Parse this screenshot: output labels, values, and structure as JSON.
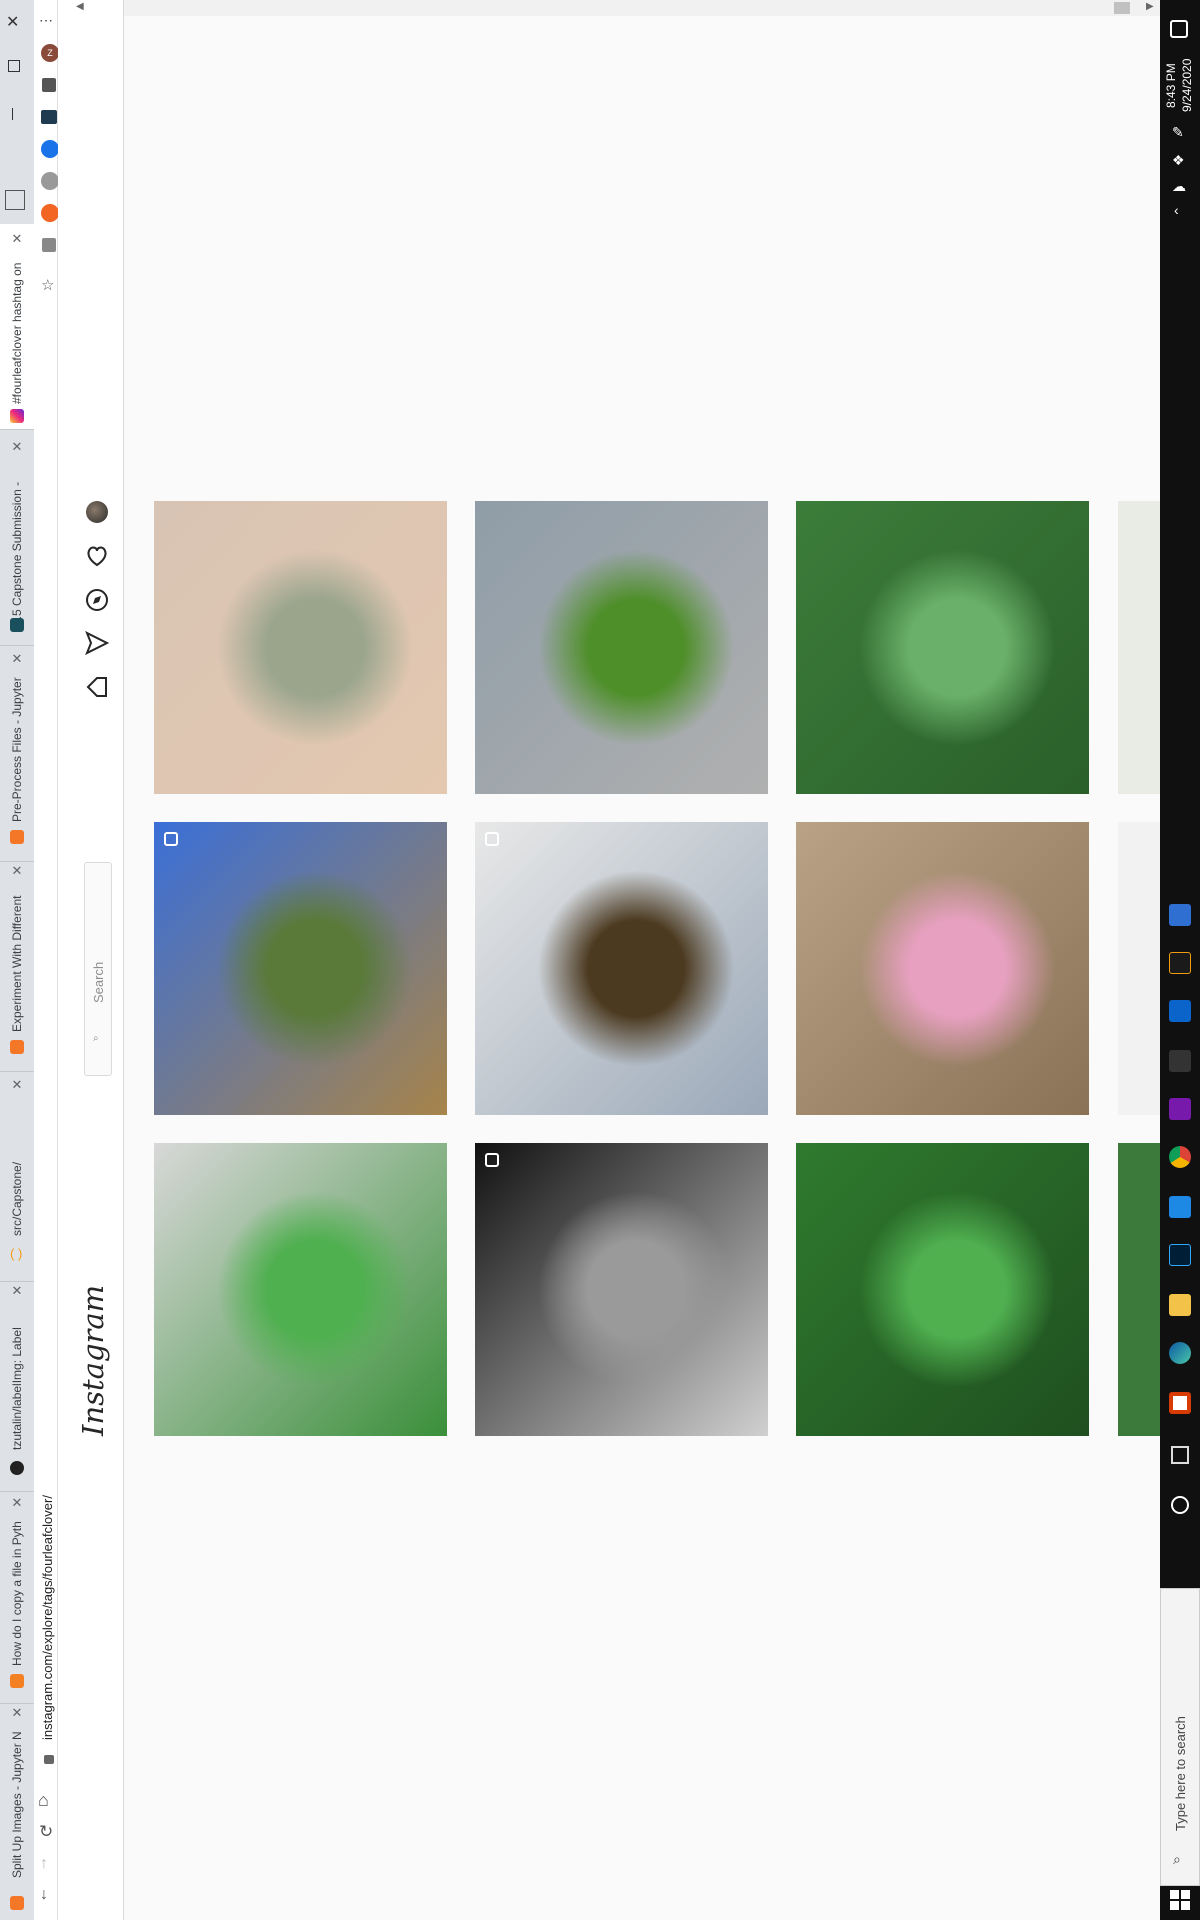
{
  "browser": {
    "tabs": [
      {
        "label": "#fourleafclover hashtag on",
        "active": true
      },
      {
        "label": "3.5 Capstone Submission -",
        "active": false
      },
      {
        "label": "Pre-Process Files - Jupyter",
        "active": false
      },
      {
        "label": "Experiment With Different",
        "active": false
      },
      {
        "label": "src/Capstone/",
        "active": false
      },
      {
        "label": "tzutalin/labelImg: Label",
        "active": false
      },
      {
        "label": "How do I copy a file in Pyth",
        "active": false
      },
      {
        "label": "Split Up Images - Jupyter N",
        "active": false
      }
    ],
    "url": "instagram.com/explore/tags/fourleafclover/",
    "url_icon": "lock-icon",
    "nav_icons": [
      "back-arrow-icon",
      "reload-icon",
      "forward-arrow-icon",
      "home-icon"
    ],
    "extension_icons": [
      "profile-icon",
      "puzzle-icon",
      "graph-icon",
      "ext-blue-icon",
      "ext-circle-icon",
      "ext-orange-icon",
      "ext-gray-icon",
      "star-icon"
    ],
    "profile_letter": "Z"
  },
  "instagram": {
    "logo": "Instagram",
    "search": {
      "placeholder": "Search"
    },
    "nav_icons": [
      "home-icon",
      "direct-icon",
      "explore-icon",
      "heart-icon",
      "avatar-icon"
    ]
  },
  "grid": {
    "tiles": [
      {
        "desc": "child-holding-clover",
        "colors": [
          "#d8c4b4",
          "#9aa58c",
          "#e4c8b0"
        ],
        "multi": false
      },
      {
        "desc": "clover-on-rock",
        "colors": [
          "#8f9da8",
          "#4f8f2a",
          "#b0b0b0"
        ],
        "multi": false
      },
      {
        "desc": "green-clover-leaves",
        "colors": [
          "#3c7d3a",
          "#6ab06a",
          "#2a5f2a"
        ],
        "multi": false
      },
      {
        "desc": "palm-trees-sky",
        "colors": [
          "#3a6fd8",
          "#5a7a3a",
          "#a7844a"
        ],
        "multi": true
      },
      {
        "desc": "clover-in-book",
        "colors": [
          "#e8e8e8",
          "#4c3a20",
          "#9aa8b8"
        ],
        "multi": true
      },
      {
        "desc": "kids-walking-path",
        "colors": [
          "#b9a285",
          "#e7a0c0",
          "#8a7256"
        ],
        "multi": false
      },
      {
        "desc": "clover-cookies",
        "colors": [
          "#d8d8d8",
          "#4fb04f",
          "#3a8f3a"
        ],
        "multi": false
      },
      {
        "desc": "smiling-man-bw",
        "colors": [
          "#111111",
          "#9a9a9a",
          "#d0d0d0"
        ],
        "multi": true
      },
      {
        "desc": "clover-patch",
        "colors": [
          "#2f7a2f",
          "#50b050",
          "#1f4f1f"
        ],
        "multi": false
      }
    ]
  },
  "taskbar": {
    "time": "8:43 PM",
    "date": "9/24/2020",
    "search_placeholder": "Type here to search",
    "app_icons": [
      "start-icon",
      "cortana-icon",
      "taskview-icon",
      "office-icon",
      "edge-icon",
      "files-icon",
      "photoshop-icon",
      "vscode-icon",
      "chrome-icon",
      "onenote-icon",
      "terminal-icon",
      "outlook-icon",
      "brackets-icon",
      "calculator-icon"
    ]
  }
}
